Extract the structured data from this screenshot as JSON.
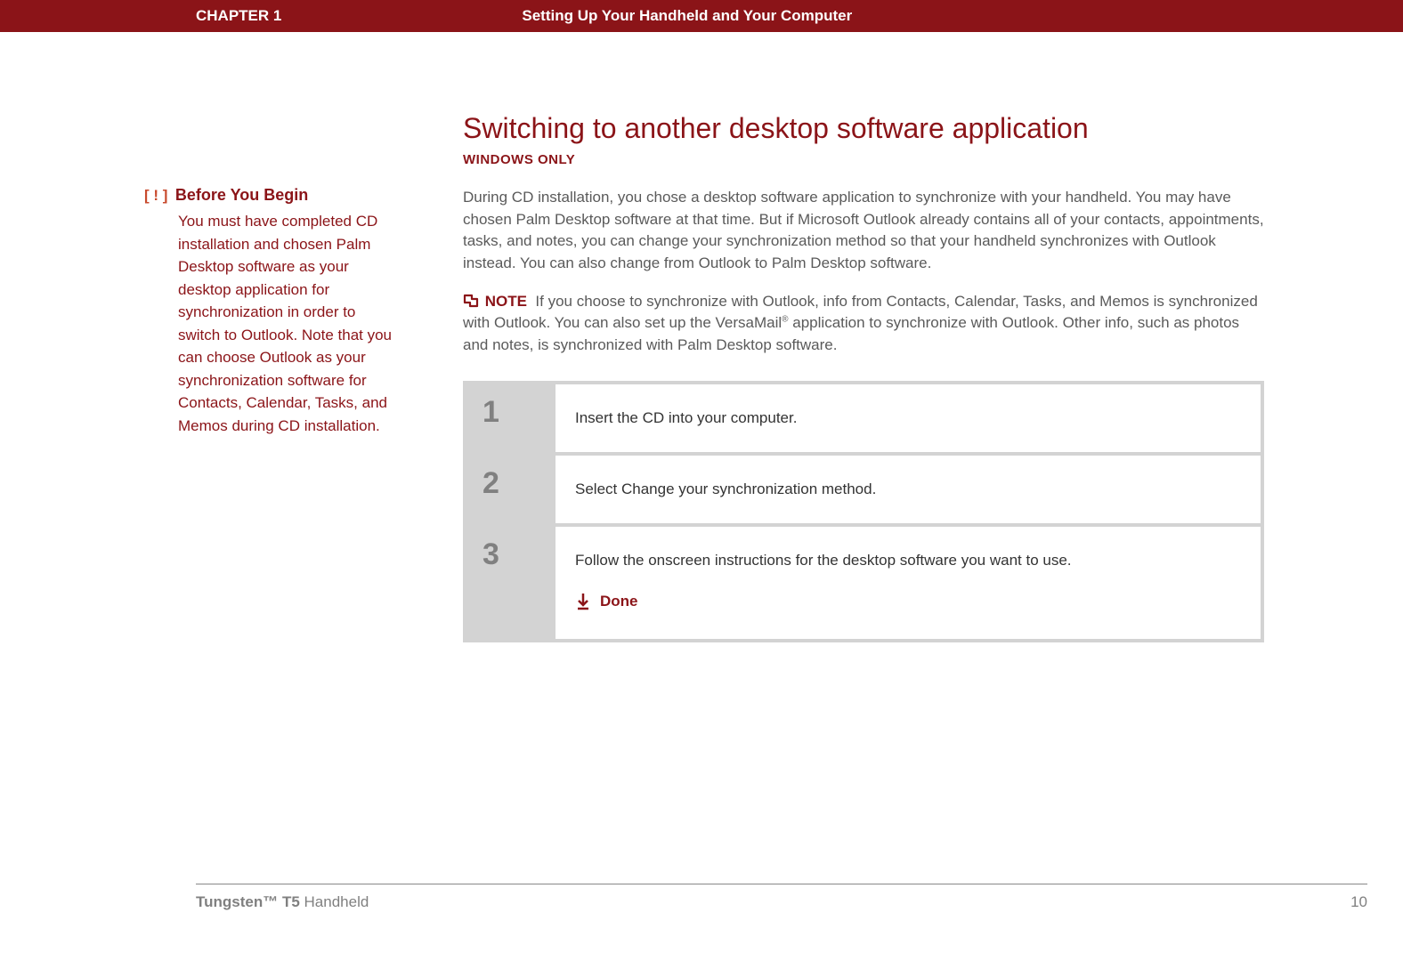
{
  "header": {
    "chapter": "CHAPTER 1",
    "title": "Setting Up Your Handheld and Your Computer"
  },
  "sidebar": {
    "before_begin": {
      "bracket": "[ ! ]",
      "heading": "Before You Begin",
      "body": "You must have completed CD installation and chosen Palm Desktop software as your desktop application for synchronization in order to switch to Outlook. Note that you can choose Outlook as your synchronization software for Contacts, Calendar, Tasks, and Memos during CD installation."
    }
  },
  "main": {
    "section_title": "Switching to another desktop software application",
    "os_label": "WINDOWS ONLY",
    "intro": "During CD installation, you chose a desktop software application to synchronize with your handheld. You may have chosen Palm Desktop software at that time. But if Microsoft Outlook already contains all of your contacts, appointments, tasks, and notes, you can change your synchronization method so that your handheld synchronizes with Outlook instead. You can also change from Outlook to Palm Desktop software.",
    "note_label": "NOTE",
    "note_body_before_mark": "If you choose to synchronize with Outlook, info from Contacts, Calendar, Tasks, and Memos is synchronized with Outlook. You can also set up the VersaMail",
    "note_body_after_mark": " application to synchronize with Outlook. Other info, such as photos and notes, is synchronized with Palm Desktop software.",
    "steps": [
      {
        "num": "1",
        "text": "Insert the CD into your computer."
      },
      {
        "num": "2",
        "text": "Select Change your synchronization method."
      },
      {
        "num": "3",
        "text": "Follow the onscreen instructions for the desktop software you want to use."
      }
    ],
    "done_label": "Done"
  },
  "footer": {
    "brand": "Tungsten™ T5",
    "model": " Handheld",
    "page": "10"
  }
}
